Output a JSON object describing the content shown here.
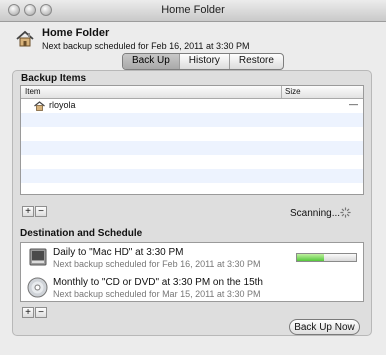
{
  "window": {
    "title": "Home Folder"
  },
  "header": {
    "title": "Home Folder",
    "subtitle": "Next backup scheduled for Feb 16, 2011 at 3:30 PM"
  },
  "tabs": [
    {
      "label": "Back Up",
      "active": true
    },
    {
      "label": "History",
      "active": false
    },
    {
      "label": "Restore",
      "active": false
    }
  ],
  "backup_items": {
    "title": "Backup Items",
    "columns": [
      "Item",
      "Size"
    ],
    "rows": [
      {
        "name": "rloyola",
        "size": "—"
      }
    ]
  },
  "buttons": {
    "add": "+",
    "remove": "−"
  },
  "status": {
    "scanning": "Scanning..."
  },
  "destinations": {
    "title": "Destination and Schedule",
    "items": [
      {
        "title": "Daily to \"Mac HD\" at 3:30 PM",
        "subtitle": "Next backup scheduled for Feb 16, 2011 at 3:30 PM",
        "progress": 0.45
      },
      {
        "title": "Monthly to \"CD or DVD\" at 3:30 PM on the 15th",
        "subtitle": "Next backup scheduled for Mar 15, 2011 at 3:30 PM"
      }
    ]
  },
  "actions": {
    "back_up_now": "Back Up Now"
  }
}
